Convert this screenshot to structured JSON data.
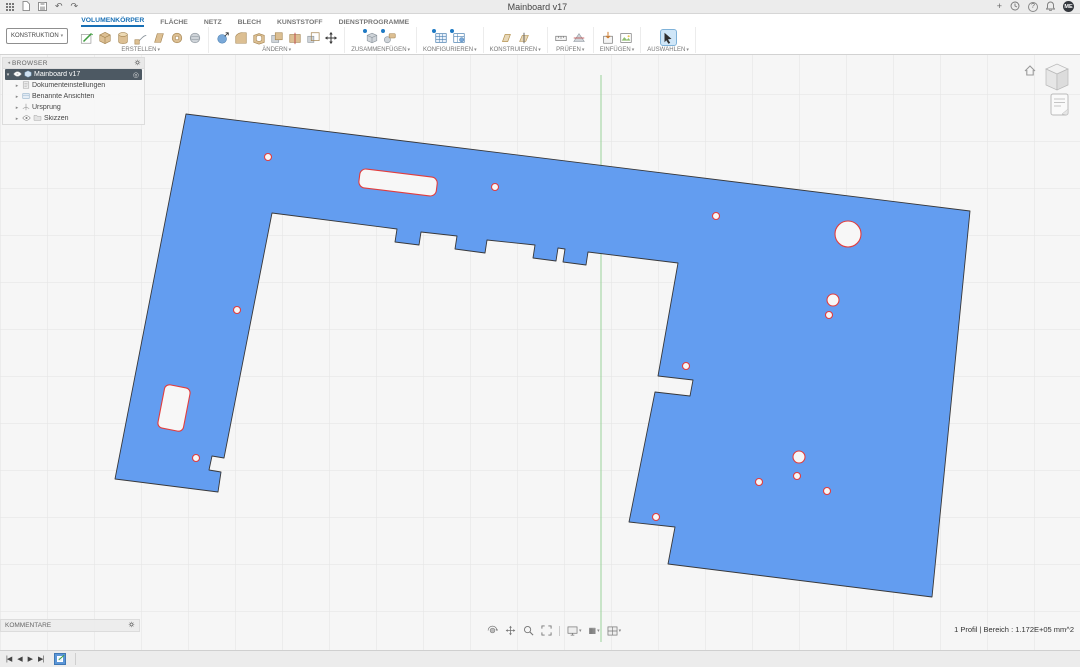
{
  "titlebar": {
    "title": "Mainboard v17",
    "avatar": "ME"
  },
  "ribbon": {
    "construction": "KONSTRUKTION",
    "tabs": [
      {
        "label": "VOLUMENKÖRPER",
        "active": true
      },
      {
        "label": "FLÄCHE"
      },
      {
        "label": "NETZ"
      },
      {
        "label": "BLECH"
      },
      {
        "label": "KUNSTSTOFF"
      },
      {
        "label": "DIENSTPROGRAMME"
      }
    ],
    "groups": [
      {
        "label": "ERSTELLEN"
      },
      {
        "label": "ÄNDERN"
      },
      {
        "label": "ZUSAMMENFÜGEN"
      },
      {
        "label": "KONFIGURIEREN"
      },
      {
        "label": "KONSTRUIEREN"
      },
      {
        "label": "PRÜFEN"
      },
      {
        "label": "EINFÜGEN"
      },
      {
        "label": "AUSWÄHLEN"
      }
    ]
  },
  "browser": {
    "header": "BROWSER",
    "items": [
      {
        "label": "Mainboard v17",
        "selected": true
      },
      {
        "label": "Dokumenteinstellungen"
      },
      {
        "label": "Benannte Ansichten"
      },
      {
        "label": "Ursprung"
      },
      {
        "label": "Skizzen"
      }
    ]
  },
  "comments": {
    "header": "KOMMENTARE"
  },
  "status": {
    "text": "1 Profil | Bereich : 1.172E+05 mm^2"
  },
  "colors": {
    "board_fill": "#639df0",
    "board_stroke": "#38383a",
    "hole_stroke": "#e23d3d",
    "axis_green": "#9ad29a",
    "tab_accent": "#176fb5",
    "selected_row": "#4d5963"
  },
  "icons": {
    "titlebar_left": [
      "app-grid-icon",
      "file-icon",
      "save-icon",
      "undo-icon",
      "redo-icon"
    ],
    "titlebar_right": [
      "add-icon",
      "history-icon",
      "help-icon",
      "bell-icon",
      "user-avatar"
    ],
    "navbar": [
      "orbit-icon",
      "pan-icon",
      "zoom-icon",
      "fit-icon",
      "display-settings-icon",
      "grid-settings-icon",
      "viewport-settings-icon"
    ],
    "timeline": [
      "go-to-start-icon",
      "step-back-icon",
      "play-icon",
      "go-to-end-icon",
      "sketch-feature-icon"
    ]
  }
}
